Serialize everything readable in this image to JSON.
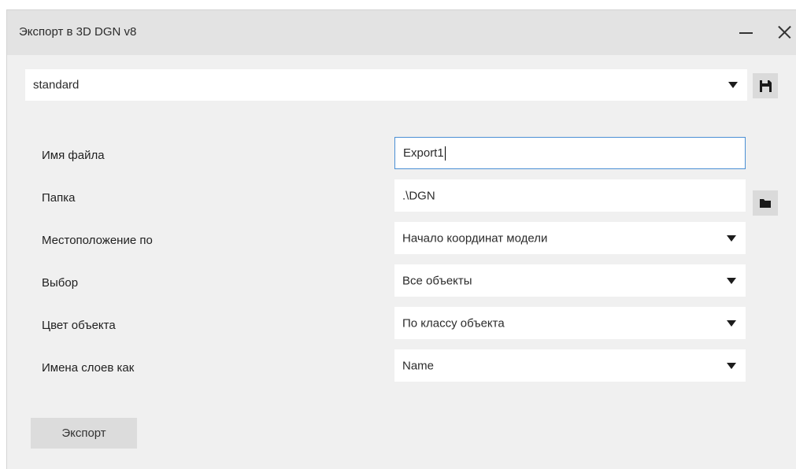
{
  "window": {
    "title": "Экспорт в 3D DGN v8"
  },
  "preset": {
    "value": "standard"
  },
  "form": {
    "filename_label": "Имя файла",
    "filename_value": "Export1",
    "folder_label": "Папка",
    "folder_value": ".\\DGN",
    "location_label": "Местоположение по",
    "location_value": "Начало координат модели",
    "selection_label": "Выбор",
    "selection_value": "Все объекты",
    "color_label": "Цвет объекта",
    "color_value": "По классу объекта",
    "layer_names_label": "Имена слоев как",
    "layer_names_value": "Name"
  },
  "actions": {
    "export_label": "Экспорт"
  },
  "icons": {
    "save": "floppy-disk-icon",
    "folder": "folder-icon",
    "minimize": "minimize-icon",
    "close": "close-icon",
    "dropdown": "chevron-down-icon"
  },
  "colors": {
    "focus_border": "#4a8fd4",
    "dialog_bg": "#f0f0f0",
    "titlebar_bg": "#e3e3e3",
    "button_bg": "#dcdcdc"
  }
}
